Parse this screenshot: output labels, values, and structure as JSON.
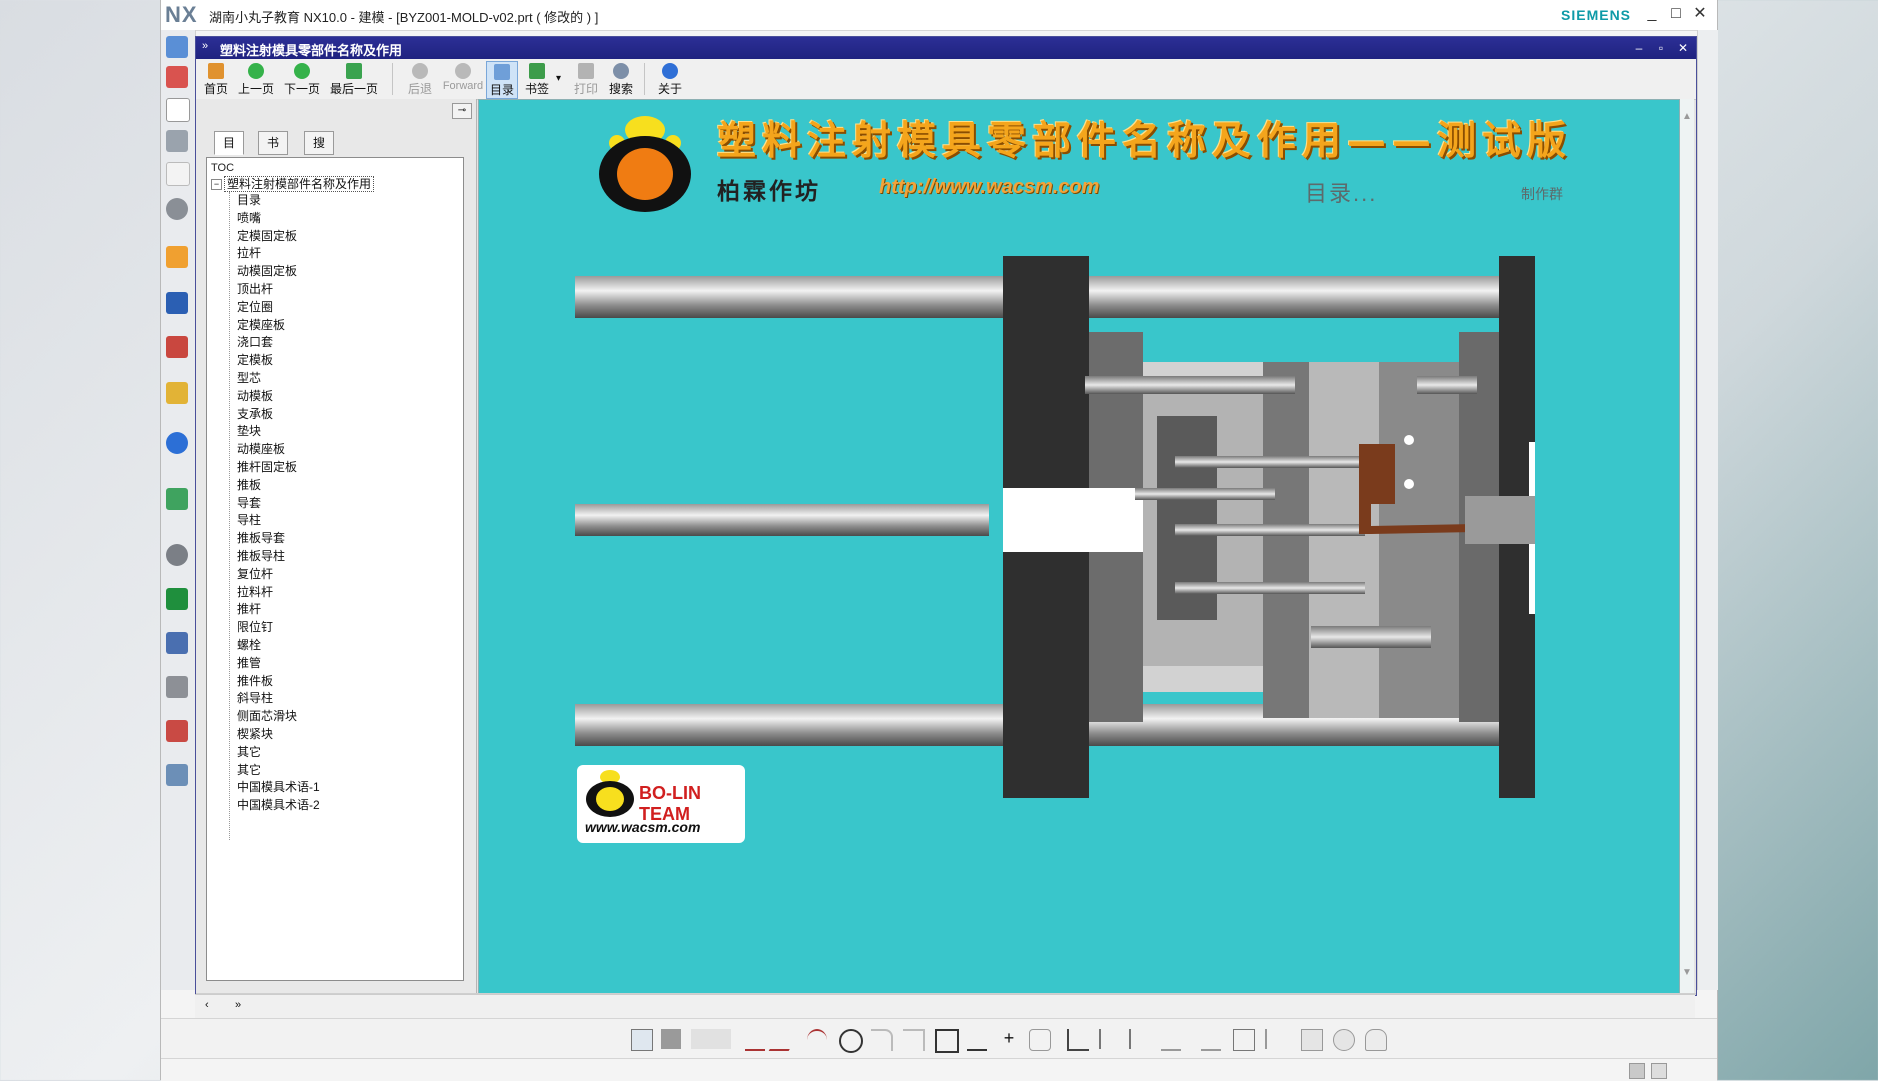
{
  "app": {
    "logo": "NX",
    "title": "湖南小丸子教育 NX10.0 - 建模 - [BYZ001-MOLD-v02.prt  ( 修改的 ) ]",
    "brand": "SIEMENS",
    "controls": [
      "_",
      "□",
      "✕"
    ]
  },
  "help_window": {
    "title": "塑料注射模具零部件名称及作用",
    "toolbar": [
      {
        "label": "首页",
        "icon": "home-icon",
        "enabled": true
      },
      {
        "label": "上一页",
        "icon": "up-arrow-icon",
        "enabled": true
      },
      {
        "label": "下一页",
        "icon": "down-arrow-icon",
        "enabled": true
      },
      {
        "label": "最后一页",
        "icon": "last-page-icon",
        "enabled": true
      },
      {
        "label": "后退",
        "icon": "back-icon",
        "enabled": false
      },
      {
        "label": "Forward",
        "icon": "forward-icon",
        "enabled": false
      },
      {
        "label": "目录",
        "icon": "toc-icon",
        "enabled": true,
        "active": true
      },
      {
        "label": "书签",
        "icon": "bookmark-icon",
        "enabled": true
      },
      {
        "label": "打印",
        "icon": "print-icon",
        "enabled": false
      },
      {
        "label": "搜索",
        "icon": "search-icon",
        "enabled": true
      },
      {
        "label": "关于",
        "icon": "info-icon",
        "enabled": true
      }
    ],
    "nav": {
      "tabs": [
        "目录",
        "书签",
        "搜索"
      ],
      "toc_label": "TOC",
      "root": "塑料注射模部件名称及作用",
      "items": [
        "目录",
        "喷嘴",
        "定模固定板",
        "拉杆",
        "动模固定板",
        "顶出杆",
        "定位圈",
        "定模座板",
        "浇口套",
        "定模板",
        "型芯",
        "动模板",
        "支承板",
        "垫块",
        "动模座板",
        "推杆固定板",
        "推板",
        "导套",
        "导柱",
        "推板导套",
        "推板导柱",
        "复位杆",
        "拉料杆",
        "推杆",
        "限位钉",
        "螺栓",
        "推管",
        "推件板",
        "斜导柱",
        "侧面芯滑块",
        "楔紧块",
        "其它",
        "其它",
        "中国模具术语-1",
        "中国模具术语-2"
      ]
    },
    "content": {
      "headline": "塑料注射模具零部件名称及作用——测试版",
      "studio": "柏霖作坊",
      "url": "http://www.wacsm.com",
      "toc_link": "目录...",
      "made_by": "制作群",
      "team_name": "BO-LIN TEAM",
      "team_url": "www.wacsm.com"
    }
  },
  "colors": {
    "content_bg": "#39c6cb",
    "titlebar": "#23268a",
    "accent": "#f4a51c"
  }
}
